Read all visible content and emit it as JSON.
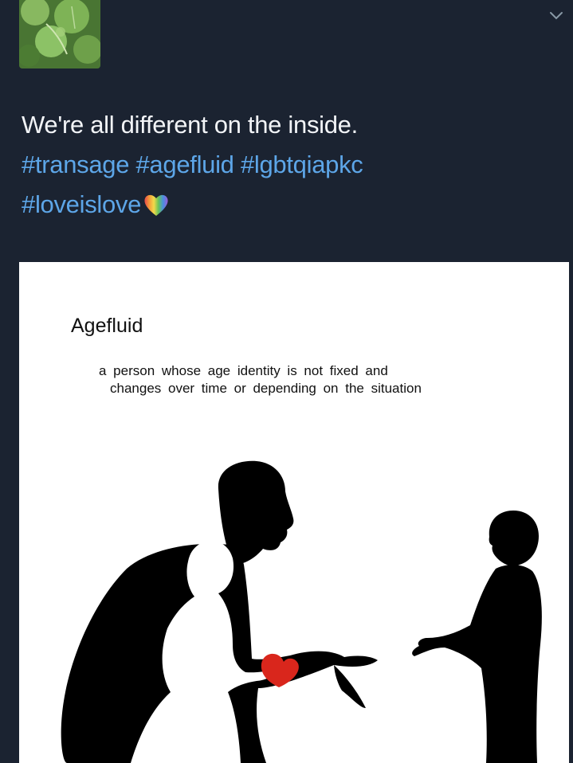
{
  "tweet": {
    "text_line1": "We're all different on the inside.",
    "hashtags_line2": "#transage #agefluid #lgbtqiapkc",
    "hashtags_line3": "#loveislove",
    "icons": {
      "avatar": "clover-avatar",
      "menu": "chevron-down-icon",
      "emoji": "rainbow-heart-icon"
    },
    "colors": {
      "background": "#1b2331",
      "text": "#f2f4f7",
      "hashtag": "#5da6e8"
    }
  },
  "media": {
    "title": "Agefluid",
    "definition_line1": "a person whose age identity is not fixed and",
    "definition_line2": "changes over time or depending on the situation",
    "illustration": "silhouette of a man with a child inside reaching toward a boy",
    "colors": {
      "background": "#ffffff",
      "silhouette": "#000000",
      "heart": "#d9261c"
    }
  }
}
